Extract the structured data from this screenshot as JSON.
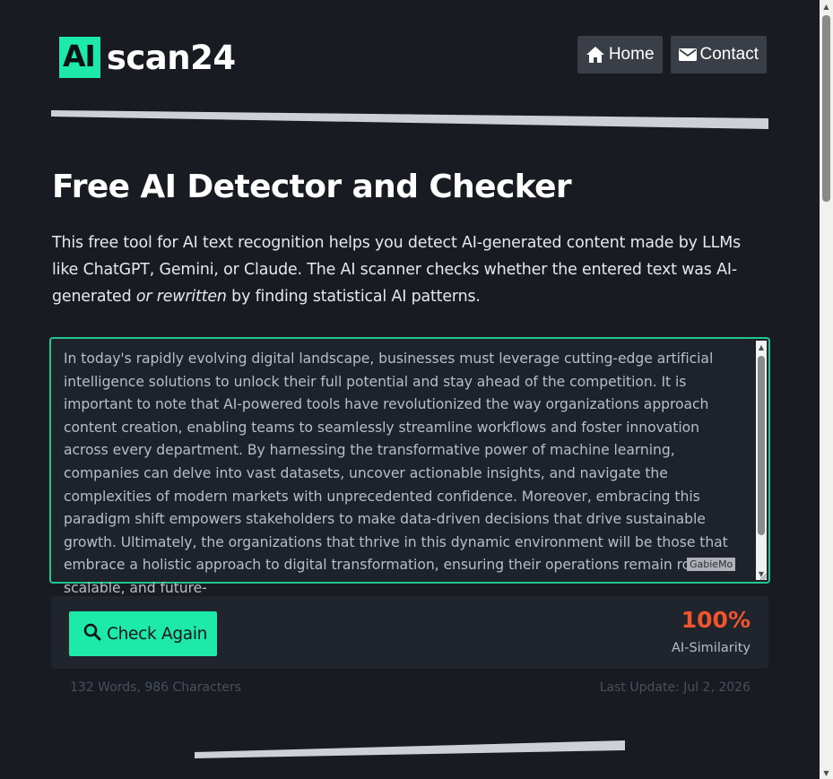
{
  "header": {
    "logo_mark": "AI",
    "logo_text": "scan24",
    "nav": [
      {
        "label": "Home",
        "icon": "home-icon"
      },
      {
        "label": "Contact",
        "icon": "envelope-icon"
      }
    ]
  },
  "main": {
    "title": "Free AI Detector and Checker",
    "intro_before": "This free tool for AI text recognition helps you detect AI-generated content made by LLMs like ChatGPT, Gemini, or Claude. The AI scanner checks whether the entered text was AI-generated ",
    "intro_em": "or rewritten",
    "intro_after": " by finding statistical AI patterns.",
    "input_text": "In today's rapidly evolving digital landscape, businesses must leverage cutting-edge artificial intelligence solutions to unlock their full potential and stay ahead of the competition. It is important to note that AI-powered tools have revolutionized the way organizations approach content creation, enabling teams to seamlessly streamline workflows and foster innovation across every department. By harnessing the transformative power of machine learning, companies can delve into vast datasets, uncover actionable insights, and navigate the complexities of modern markets with unprecedented confidence. Moreover, embracing this paradigm shift empowers stakeholders to make data-driven decisions that drive sustainable growth. Ultimately, the organizations that thrive in this dynamic environment will be those that embrace a holistic approach to digital transformation, ensuring their operations remain robust, scalable, and future-",
    "watermark": "GabieMo"
  },
  "result": {
    "check_button": "Check Again",
    "score": "100%",
    "score_label": "AI-Similarity",
    "counts": "132 Words, 986 Characters",
    "last_update": "Last Update: Jul 2, 2026"
  },
  "colors": {
    "accent": "#1de9a8",
    "score": "#f2552c",
    "background": "#181b22"
  }
}
